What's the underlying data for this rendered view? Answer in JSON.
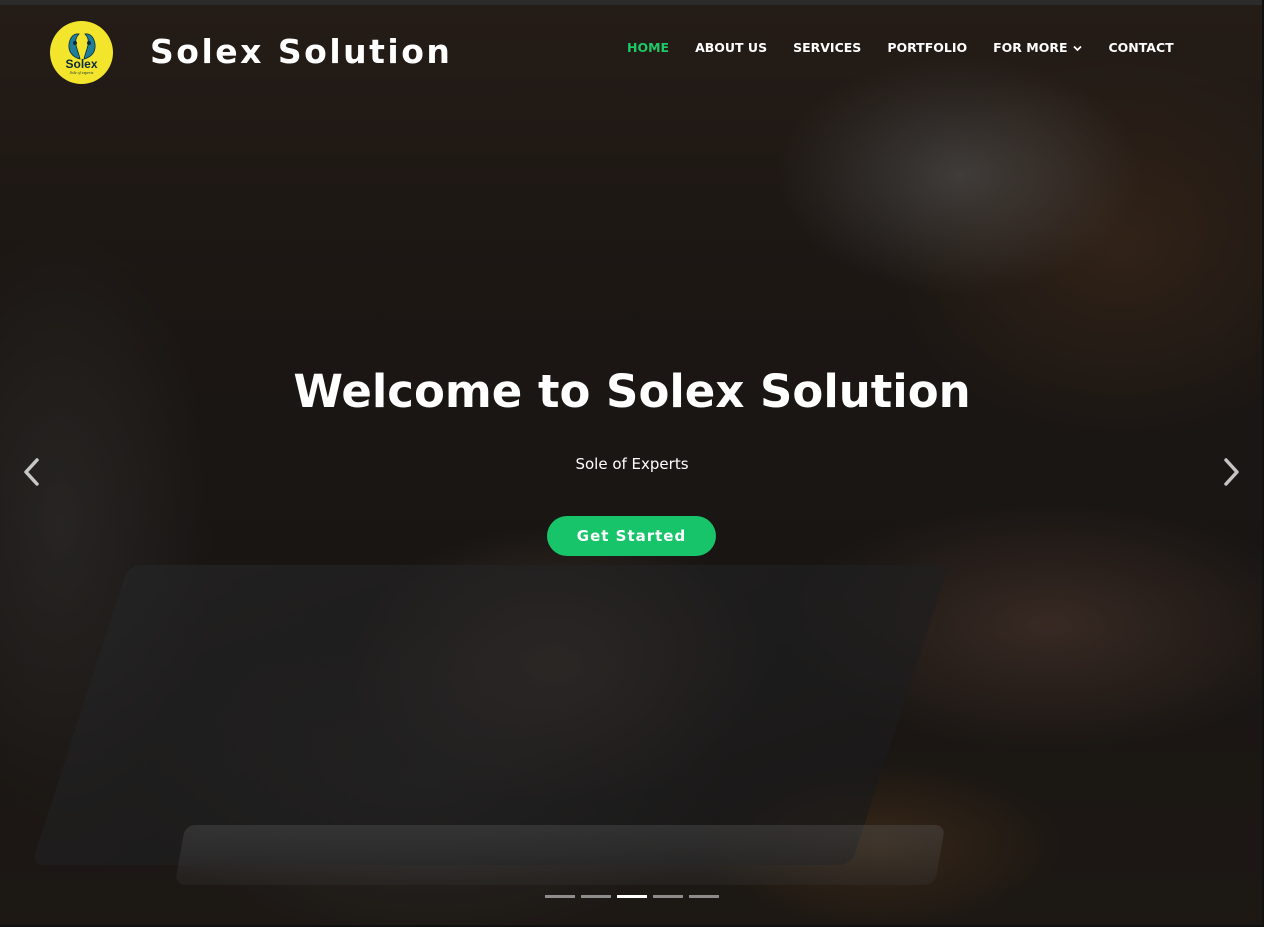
{
  "brand": {
    "logo_text": "Solex",
    "logo_tagline": "Sole of experts",
    "name": "Solex Solution"
  },
  "nav": {
    "items": [
      {
        "label": "HOME",
        "active": true
      },
      {
        "label": "ABOUT US"
      },
      {
        "label": "SERVICES"
      },
      {
        "label": "PORTFOLIO"
      },
      {
        "label": "FOR MORE",
        "icon": "chevron-down-icon"
      },
      {
        "label": "CONTACT"
      }
    ]
  },
  "hero": {
    "title": "Welcome to Solex Solution",
    "subtitle": "Sole of Experts",
    "cta_label": "Get Started",
    "prev_icon": "chevron-left-icon",
    "next_icon": "chevron-right-icon"
  },
  "carousel": {
    "slide_count": 5,
    "active_index": 2
  },
  "colors": {
    "accent": "#1ec867",
    "button": "#18c46a",
    "logo_bg": "#f2e52b",
    "text": "#ffffff"
  }
}
